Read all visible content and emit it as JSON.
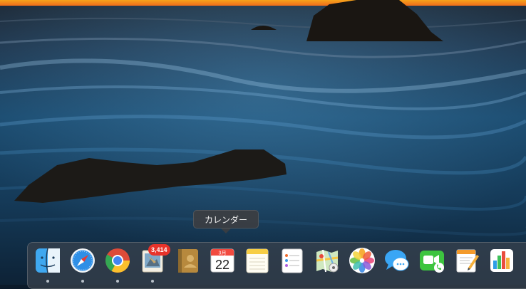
{
  "tooltip": {
    "label": "カレンダー"
  },
  "dock": {
    "badge_mail": "3,414",
    "calendar": {
      "month": "3月",
      "day": "22"
    }
  }
}
